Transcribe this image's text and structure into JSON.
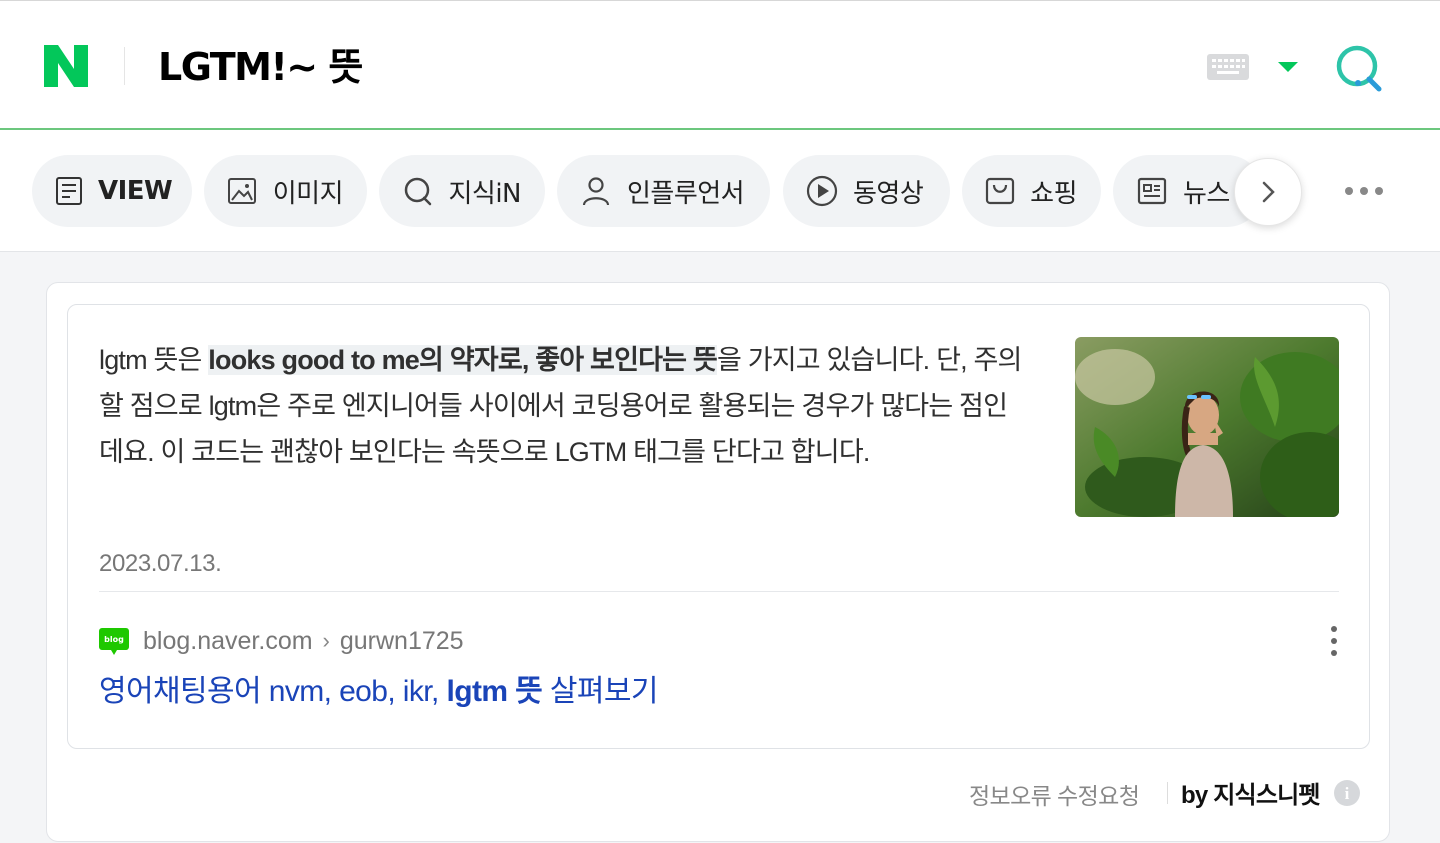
{
  "header": {
    "logo_letter": "N",
    "query": "LGTM!~ 뜻",
    "brand_color": "#03c75a",
    "search_accent": "#2ec4a9"
  },
  "tabs": [
    {
      "label": "VIEW",
      "icon": "document-icon"
    },
    {
      "label": "이미지",
      "icon": "image-icon"
    },
    {
      "label": "지식iN",
      "icon": "kin-search-icon"
    },
    {
      "label": "인플루언서",
      "icon": "person-icon"
    },
    {
      "label": "동영상",
      "icon": "play-icon"
    },
    {
      "label": "쇼핑",
      "icon": "shopping-bag-icon"
    },
    {
      "label": "뉴스",
      "icon": "newspaper-icon"
    }
  ],
  "snippet": {
    "answer_pre": "lgtm 뜻은 ",
    "answer_highlight": "looks good to me의 약자로, 좋아 보인다는 뜻",
    "answer_post": "을 가지고 있습니다. 단, 주의할 점으로 lgtm은 주로 엔지니어들 사이에서 코딩용어로 활용되는 경우가 많다는 점인데요. 이 코드는 괜찮아 보인다는 속뜻으로 LGTM 태그를 단다고 합니다.",
    "date": "2023.07.13.",
    "source_site": "blog.naver.com",
    "source_arrow": "›",
    "source_user": "gurwn1725",
    "blog_badge": "blog",
    "link_pre": "영어채팅용어 nvm, eob, ikr, ",
    "link_bold": "lgtm 뜻",
    "link_post": " 살펴보기",
    "link_color": "#1a44b8"
  },
  "footer": {
    "report_label": "정보오류 수정요청",
    "by_label": "by 지식스니펫",
    "info_icon_glyph": "i"
  }
}
